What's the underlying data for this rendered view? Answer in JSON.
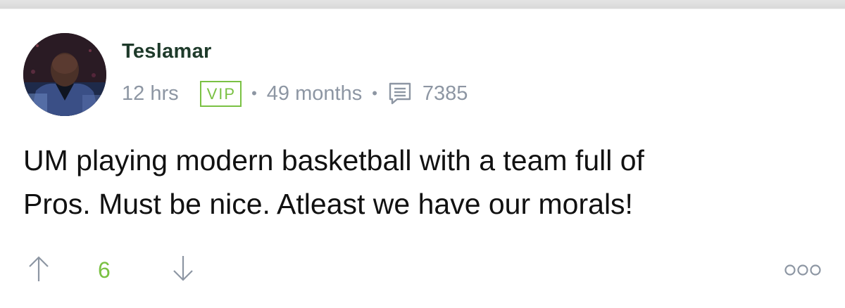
{
  "comment": {
    "username": "Teslamar",
    "time_ago": "12 hrs",
    "badge": "VIP",
    "member_duration": "49 months",
    "post_count": "7385",
    "body_lines": [
      "UM playing modern basketball with a team full of",
      "Pros. Must be nice. Atleast we have our morals!"
    ],
    "votes": "6",
    "icons": {
      "upvote": "arrow-up-icon",
      "downvote": "arrow-down-icon",
      "posts": "message-icon",
      "more": "more-options-icon"
    }
  },
  "colors": {
    "username": "#1e3a2a",
    "meta": "#8d96a3",
    "accent_green": "#7ac143",
    "body_text": "#111111"
  }
}
